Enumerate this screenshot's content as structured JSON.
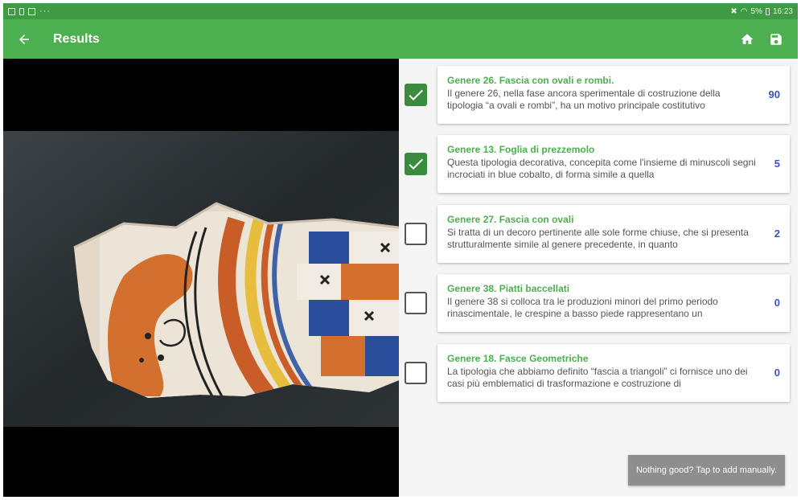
{
  "status_bar": {
    "left_icons": [
      "image-notification-icon",
      "battery-notification-icon",
      "mail-notification-icon"
    ],
    "more": "···",
    "right_text": "5%",
    "time": "16:23"
  },
  "app_bar": {
    "title": "Results",
    "color": "#4caf50",
    "status_color": "#3e9b43"
  },
  "results": [
    {
      "checked": true,
      "title": "Genere 26. Fascia con ovali e rombi.",
      "description": "Il genere 26, nella fase ancora sperimentale di costruzione della tipologia “a ovali e rombi”, ha un motivo principale costitutivo",
      "count": "90"
    },
    {
      "checked": true,
      "title": "Genere 13. Foglia di prezzemolo",
      "description": "Questa tipologia decorativa, concepita come l'insieme di minuscoli segni incrociati in blue cobalto, di forma simile a quella",
      "count": "5"
    },
    {
      "checked": false,
      "title": "Genere 27. Fascia con ovali",
      "description": "Si tratta di un decoro pertinente alle sole forme chiuse, che si presenta strutturalmente simile al genere precedente, in quanto",
      "count": "2"
    },
    {
      "checked": false,
      "title": "Genere 38. Piatti baccellati",
      "description": "Il genere 38 si colloca tra le produzioni minori del primo periodo rinascimentale, le crespine a basso piede rappresentano un",
      "count": "0"
    },
    {
      "checked": false,
      "title": "Genere 18. Fasce Geometriche",
      "description": "La tipologia che abbiamo definito “fascia a triangoli” ci fornisce uno dei casi più emblematici di trasformazione e costruzione di",
      "count": "0"
    }
  ],
  "toast": {
    "label": "Nothing good? Tap to add manually."
  },
  "colors": {
    "accent": "#4caf50",
    "checkbox_checked": "#3a8b3e",
    "count": "#3f51b5"
  }
}
